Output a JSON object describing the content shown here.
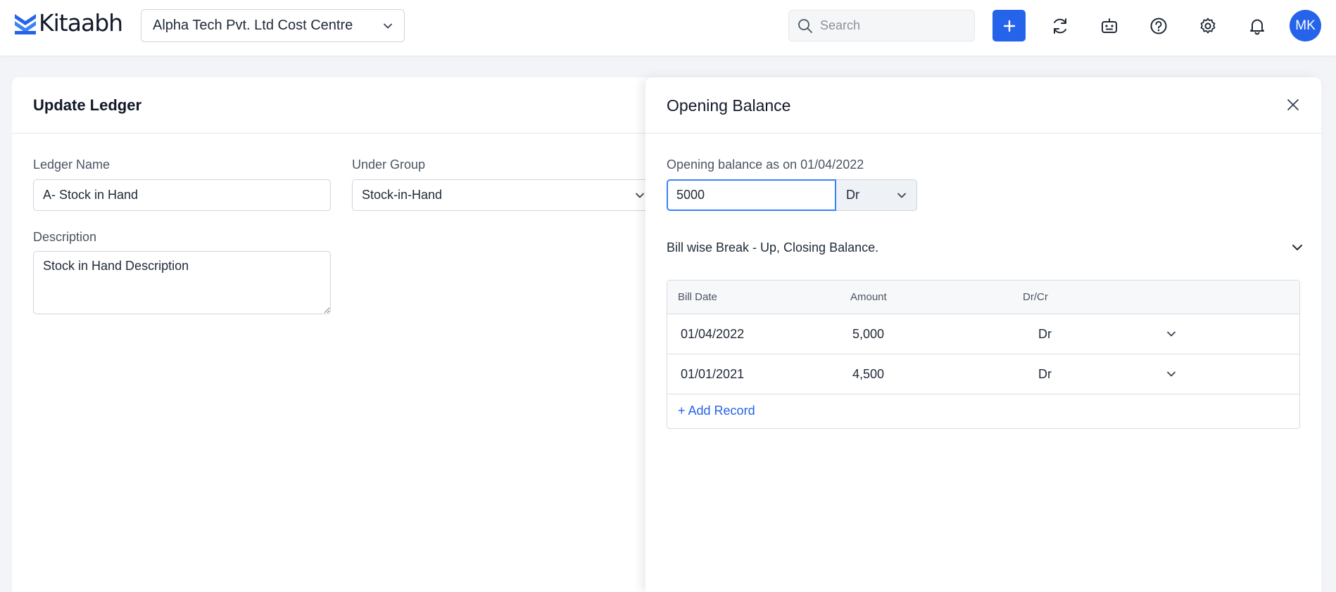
{
  "header": {
    "logo_text": "Kitaabh",
    "company": "Alpha Tech Pvt. Ltd Cost Centre",
    "search_placeholder": "Search",
    "add_icon": "plus-icon",
    "icons": [
      "refresh-icon",
      "bot-icon",
      "help-icon",
      "gear-icon",
      "bell-icon"
    ],
    "avatar_initials": "MK",
    "accent": "#2563eb"
  },
  "ledger_form": {
    "title": "Update Ledger",
    "ledger_name_label": "Ledger Name",
    "ledger_name_value": "A- Stock in Hand",
    "under_group_label": "Under Group",
    "under_group_value": "Stock-in-Hand",
    "description_label": "Description",
    "description_value": "Stock in Hand Description"
  },
  "opening_balance": {
    "title": "Opening Balance",
    "as_on_label": "Opening balance as on 01/04/2022",
    "amount_value": "5000",
    "drcr_value": "Dr",
    "bill_wise_label": "Bill wise Break - Up, Closing Balance.",
    "table": {
      "columns": [
        "Bill Date",
        "Amount",
        "Dr/Cr"
      ],
      "rows": [
        {
          "date": "01/04/2022",
          "amount": "5,000",
          "drcr": "Dr"
        },
        {
          "date": "01/01/2021",
          "amount": "4,500",
          "drcr": "Dr"
        }
      ],
      "add_record_label": "+ Add Record"
    }
  }
}
